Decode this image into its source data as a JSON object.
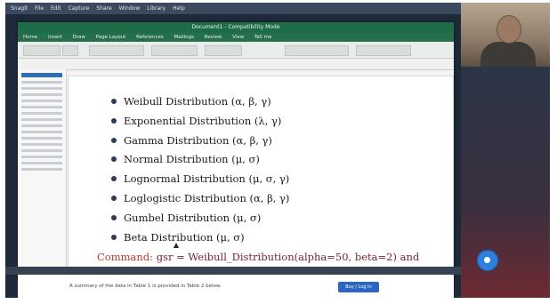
{
  "mac_menubar": {
    "items": [
      "Snagit",
      "File",
      "Edit",
      "Capture",
      "Share",
      "Window",
      "Library",
      "Help"
    ]
  },
  "word": {
    "title": "Document1 - Compatibility Mode",
    "menu": [
      "Home",
      "Insert",
      "Draw",
      "Page Layout",
      "References",
      "Mailings",
      "Review",
      "View",
      "Tell me"
    ]
  },
  "slide": {
    "bullets": [
      "Weibull Distribution (α, β, γ)",
      "Exponential Distribution (λ, γ)",
      "Gamma Distribution (α, β, γ)",
      "Normal Distribution (μ, σ)",
      "Lognormal Distribution (μ, σ, γ)",
      "Loglogistic Distribution (α, β, γ)",
      "Gumbel Distribution (μ, σ)",
      "Beta Distribution (μ, σ)"
    ],
    "command_label": "Command:",
    "command_code": "gsr = Weibull_Distribution(alpha=50, beta=2) and"
  },
  "underlying_page": {
    "text": "A summary of the data in Table 1 is provided in Table 2 below.",
    "button_label": "Buy / Log In"
  },
  "colors": {
    "word_green": "#1d6b47",
    "command_red": "#b53a2a",
    "fab_blue": "#2f7fe0"
  }
}
